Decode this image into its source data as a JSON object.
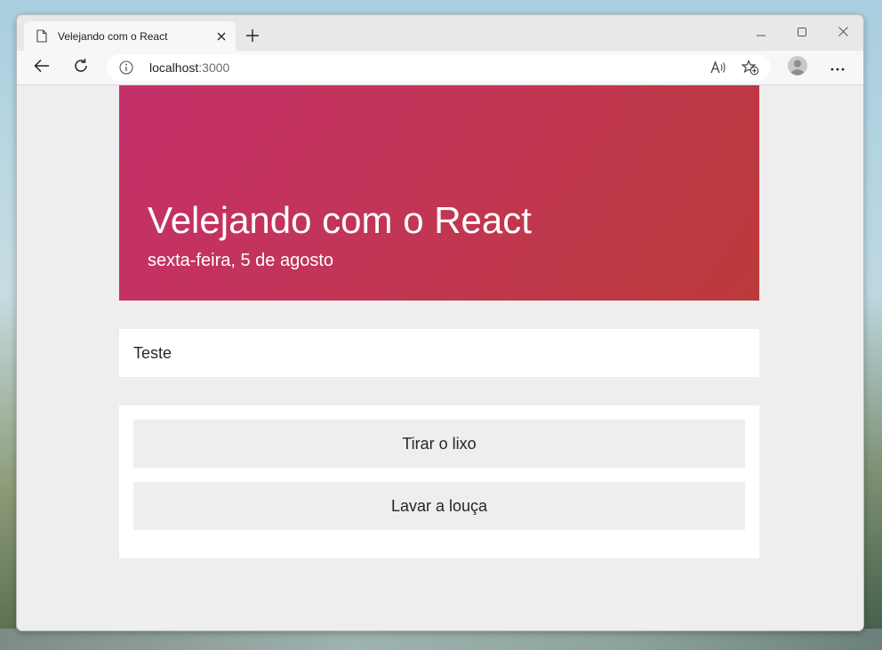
{
  "browser": {
    "tab_title": "Velejando com o React",
    "url_host": "localhost",
    "url_port": ":3000"
  },
  "page": {
    "title": "Velejando com o React",
    "subtitle": "sexta-feira, 5 de agosto",
    "input_value": "Teste",
    "tasks": [
      {
        "label": "Tirar o lixo"
      },
      {
        "label": "Lavar a louça"
      }
    ]
  },
  "colors": {
    "hero_start": "#c4306a",
    "hero_end": "#bb3b3b",
    "page_background": "#eeeeee"
  },
  "icons": [
    "page-icon",
    "close-icon",
    "plus-icon",
    "minimize-icon",
    "maximize-icon",
    "window-close-icon",
    "back-arrow-icon",
    "refresh-icon",
    "info-icon",
    "read-aloud-icon",
    "add-favorite-icon",
    "profile-avatar-icon",
    "more-menu-icon"
  ]
}
